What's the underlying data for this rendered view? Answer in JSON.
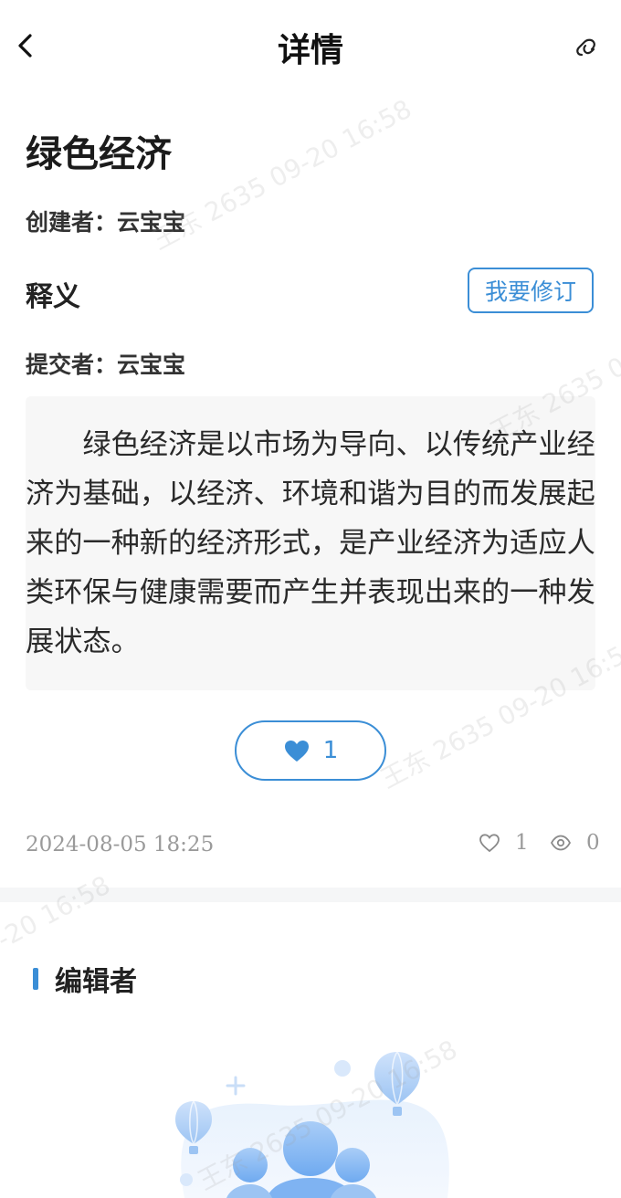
{
  "header": {
    "title": "详情"
  },
  "entry": {
    "title": "绿色经济",
    "creator": "创建者：云宝宝",
    "section_label": "释义",
    "revise_button": "我要修订",
    "submitter": "提交者：云宝宝",
    "definition": "绿色经济是以市场为导向、以传统产业经济为基础，以经济、环境和谐为目的而发展起来的一种新的经济形式，是产业经济为适应人类环保与健康需要而产生并表现出来的一种发展状态。"
  },
  "like_button": {
    "count": "1"
  },
  "meta": {
    "date": "2024-08-05 18:25",
    "likes": "1",
    "views": "0"
  },
  "editors": {
    "title": "编辑者"
  },
  "watermark": "王东 2635 09-20 16:58",
  "colors": {
    "accent": "#3b8ed6",
    "muted_text": "#9a9a9a",
    "definition_bg": "#f7f7f7"
  },
  "icons": {
    "back": "chevron-left-icon",
    "share": "share-link-icon",
    "like_button": "heart-filled-icon",
    "likes": "heart-outline-icon",
    "views": "eye-icon",
    "empty_state": "empty-state-illustration"
  }
}
